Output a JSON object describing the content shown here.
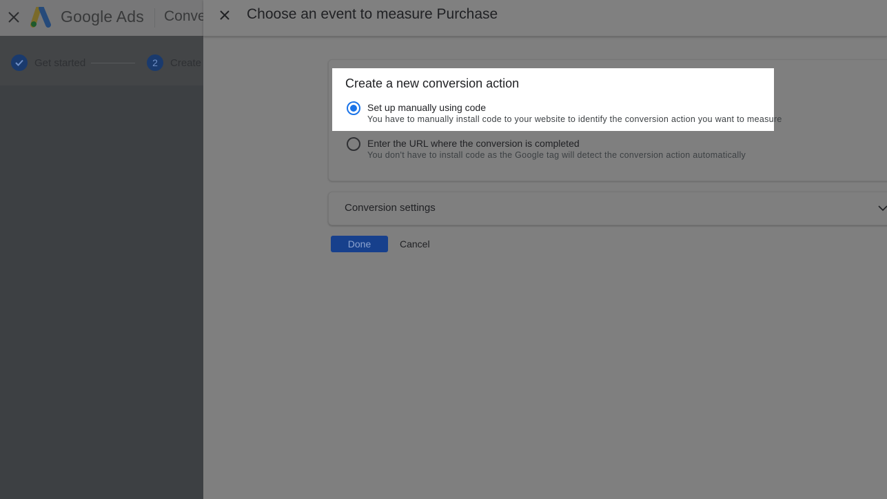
{
  "background_app": {
    "brand": "Google Ads",
    "title_partial": "Conve",
    "steps": [
      {
        "label": "Get started",
        "status": "done"
      },
      {
        "number": "2",
        "label": "Create"
      }
    ]
  },
  "panel": {
    "title": "Choose an event to measure Purchase",
    "section_title": "Create a new conversion action",
    "options": [
      {
        "label": "Set up manually using code",
        "description": "You have to manually install code to your website to identify the conversion action you want to measure",
        "selected": true
      },
      {
        "label": "Enter the URL where the conversion is completed",
        "description": "You don't have to install code as the Google tag will detect the conversion action automatically",
        "selected": false
      }
    ],
    "settings_label": "Conversion settings",
    "done_label": "Done",
    "cancel_label": "Cancel"
  },
  "colors": {
    "accent": "#1a73e8",
    "done_button": "#17408c"
  }
}
